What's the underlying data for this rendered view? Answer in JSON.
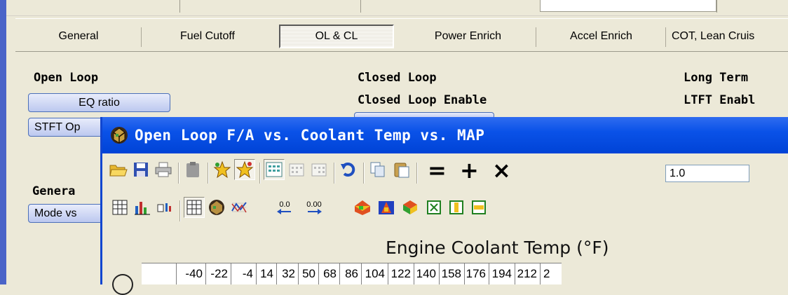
{
  "tabs": [
    {
      "label": "General"
    },
    {
      "label": "Fuel Cutoff"
    },
    {
      "label": "OL & CL"
    },
    {
      "label": "Power Enrich"
    },
    {
      "label": "Accel Enrich"
    },
    {
      "label": "COT, Lean Cruis"
    }
  ],
  "sections": {
    "open_loop": "Open Loop",
    "closed_loop": "Closed Loop",
    "closed_loop_enable": "Closed Loop Enable",
    "long_term": "Long Term",
    "ltft_enable": "LTFT Enabl",
    "general": "Genera"
  },
  "buttons": {
    "eq_ratio": "EQ ratio",
    "stft": "STFT Op",
    "mode": "Mode vs"
  },
  "window": {
    "title": "Open Loop F/A vs. Coolant Temp vs. MAP",
    "value_input": "1.0",
    "ops": {
      "eq": "=",
      "plus": "+",
      "times": "×"
    },
    "small_labels": {
      "a": "0.0",
      "b": "0.00"
    }
  },
  "chart": {
    "title": "Engine Coolant Temp (°F)",
    "columns": [
      "",
      "-40",
      "-22",
      "-4",
      "14",
      "32",
      "50",
      "68",
      "86",
      "104",
      "122",
      "140",
      "158",
      "176",
      "194",
      "212",
      "2"
    ]
  },
  "colors": {
    "titlebar": "#0a52e8",
    "pill": "#bcc8ef",
    "accent": "#1146d0"
  }
}
